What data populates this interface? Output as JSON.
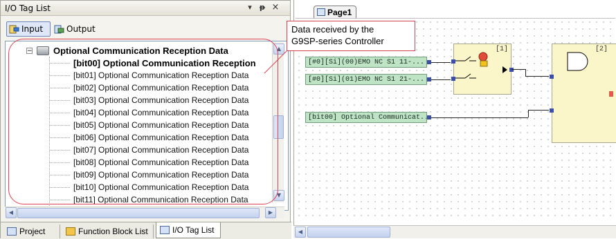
{
  "panel": {
    "title": "I/O Tag List",
    "pin_glyph": "▾",
    "dock_glyph": "#",
    "close_glyph": "×",
    "toolbar": {
      "input_label": "Input",
      "output_label": "Output"
    }
  },
  "tree": {
    "root_label": "Optional Communication Reception Data",
    "root_toggle": "−",
    "items": [
      "[bit00] Optional Communication Reception",
      "[bit01] Optional Communication Reception Data",
      "[bit02] Optional Communication Reception Data",
      "[bit03] Optional Communication Reception Data",
      "[bit04] Optional Communication Reception Data",
      "[bit05] Optional Communication Reception Data",
      "[bit06] Optional Communication Reception Data",
      "[bit07] Optional Communication Reception Data",
      "[bit08] Optional Communication Reception Data",
      "[bit09] Optional Communication Reception Data",
      "[bit10] Optional Communication Reception Data",
      "[bit11] Optional Communication Reception Data"
    ]
  },
  "callout": {
    "line1": "Data received by the",
    "line2": "G9SP-series Controller",
    "color": "#d94050"
  },
  "bottom_tabs": {
    "project": "Project",
    "function_block_list": "Function Block List",
    "io_tag_list": "I/O Tag List"
  },
  "canvas": {
    "page_tab": "Page1",
    "tag1": "[#0][Si](00)EMO NC S1 11-...",
    "tag2": "[#0][Si](01)EMO NC S1 21-...",
    "tag3": "[bit00] Optional Communicat...",
    "fb1_number": "[1]",
    "fb2_number": "[2]"
  },
  "colors": {
    "tag_green": "#bfe3c5",
    "fb_yellow": "#fbf6c9",
    "pin_blue": "#3a4fa8",
    "pin_red": "#e15a4c"
  }
}
